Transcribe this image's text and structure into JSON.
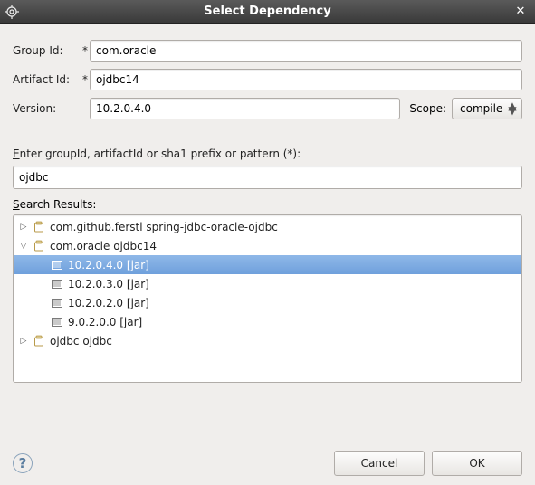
{
  "window": {
    "title": "Select Dependency"
  },
  "form": {
    "groupIdLabel": "Group Id:",
    "groupIdValue": "com.oracle",
    "artifactIdLabel": "Artifact Id:",
    "artifactIdValue": "ojdbc14",
    "versionLabel": "Version:",
    "versionValue": "10.2.0.4.0",
    "scopeLabel": "Scope:",
    "scopeValue": "compile",
    "requiredMark": "*"
  },
  "search": {
    "hintPrefix": "E",
    "hintRest": "nter groupId, artifactId or sha1 prefix or pattern (*):",
    "value": "ojdbc"
  },
  "results": {
    "labelPrefix": "S",
    "labelRest": "earch Results:",
    "items": [
      {
        "expanded": false,
        "type": "group",
        "label": "com.github.ferstl   spring-jdbc-oracle-ojdbc"
      },
      {
        "expanded": true,
        "type": "group",
        "label": "com.oracle   ojdbc14",
        "children": [
          {
            "type": "version",
            "label": "10.2.0.4.0 [jar]",
            "selected": true
          },
          {
            "type": "version",
            "label": "10.2.0.3.0 [jar]",
            "selected": false
          },
          {
            "type": "version",
            "label": "10.2.0.2.0 [jar]",
            "selected": false
          },
          {
            "type": "version",
            "label": "9.0.2.0.0 [jar]",
            "selected": false
          }
        ]
      },
      {
        "expanded": false,
        "type": "group",
        "label": "ojdbc   ojdbc"
      }
    ]
  },
  "buttons": {
    "cancel": "Cancel",
    "ok": "OK"
  }
}
